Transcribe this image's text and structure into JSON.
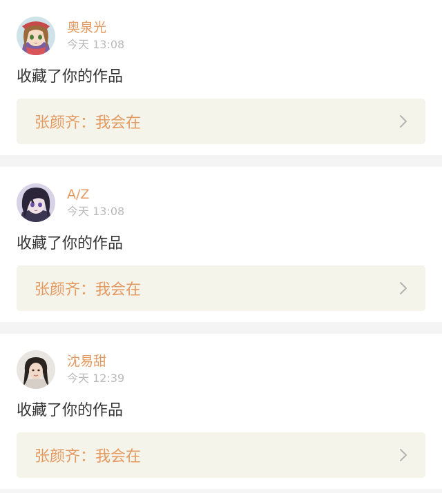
{
  "notifications": [
    {
      "username": "奥泉光",
      "time": "今天 13:08",
      "action": "收藏了你的作品",
      "reference": "张颜齐：我会在",
      "avatar_icon": "anime-girl-avatar-icon"
    },
    {
      "username": "A/Z",
      "time": "今天 13:08",
      "action": "收藏了你的作品",
      "reference": "张颜齐：我会在",
      "avatar_icon": "anime-dark-hair-avatar-icon"
    },
    {
      "username": "沈易甜",
      "time": "今天 12:39",
      "action": "收藏了你的作品",
      "reference": "张颜齐：我会在",
      "avatar_icon": "photo-girl-avatar-icon"
    }
  ],
  "colors": {
    "accent": "#e59a62",
    "time_gray": "#b9b9b9",
    "reference_bg": "#f4f4ea",
    "separator": "#f4f4f4"
  }
}
